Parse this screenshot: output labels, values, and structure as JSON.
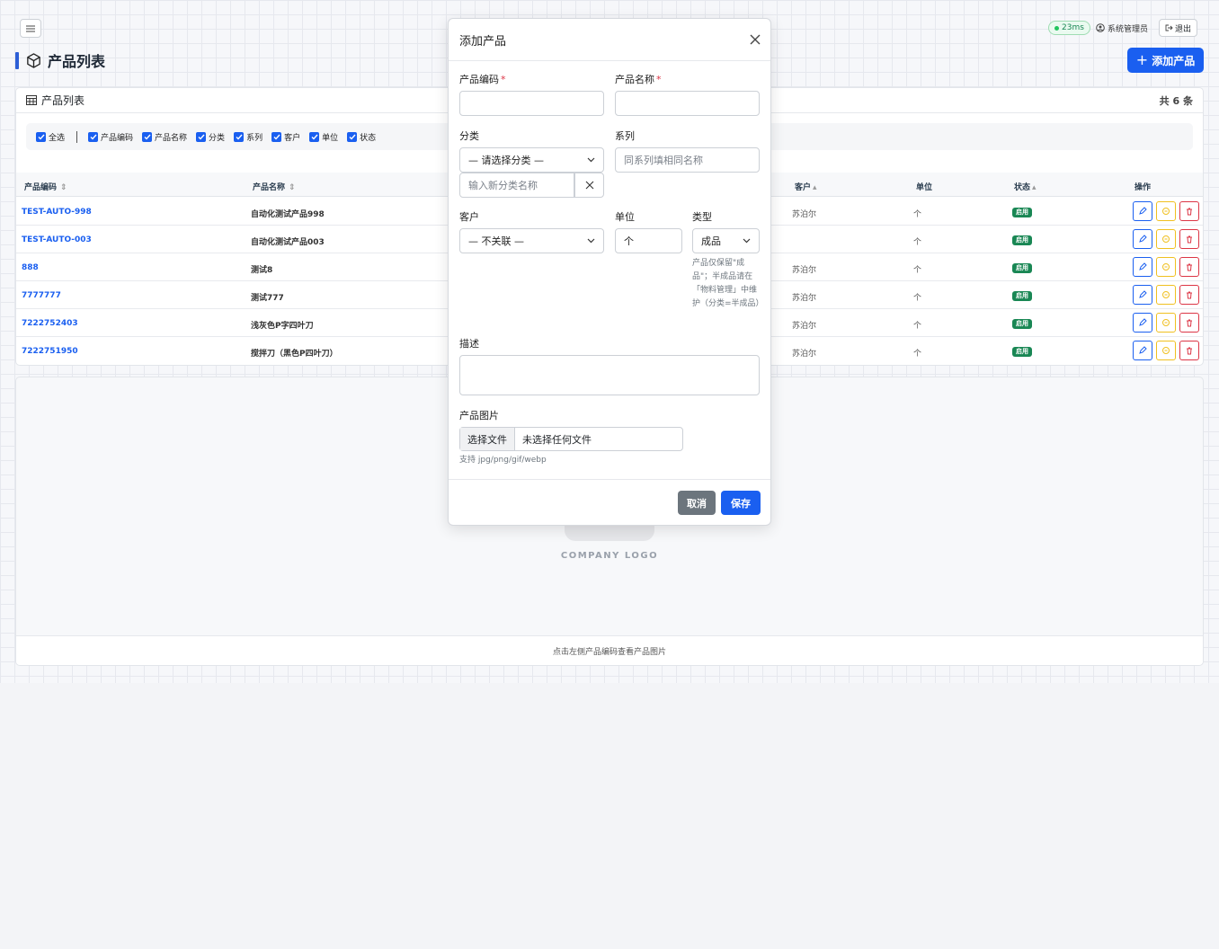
{
  "header": {
    "latency": "23ms",
    "user": "系统管理员",
    "logout": "退出"
  },
  "page": {
    "title": "产品列表",
    "add_button": "添加产品"
  },
  "list": {
    "title": "产品列表",
    "count": "共 6 条",
    "filters": [
      "全选",
      "产品编码",
      "产品名称",
      "分类",
      "系列",
      "客户",
      "单位",
      "状态"
    ],
    "columns": {
      "code": "产品编码",
      "name": "产品名称",
      "customer": "客户",
      "unit": "单位",
      "status": "状态",
      "actions": "操作"
    },
    "rows": [
      {
        "code": "TEST-AUTO-998",
        "name": "自动化测试产品998",
        "customer": "苏泊尔",
        "unit": "个",
        "status": "启用"
      },
      {
        "code": "TEST-AUTO-003",
        "name": "自动化测试产品003",
        "customer": "",
        "unit": "个",
        "status": "启用"
      },
      {
        "code": "888",
        "name": "测试8",
        "customer": "苏泊尔",
        "unit": "个",
        "status": "启用"
      },
      {
        "code": "7777777",
        "name": "测试777",
        "customer": "苏泊尔",
        "unit": "个",
        "status": "启用"
      },
      {
        "code": "7222752403",
        "name": "浅灰色P字四叶刀",
        "customer": "苏泊尔",
        "unit": "个",
        "status": "启用"
      },
      {
        "code": "7222751950",
        "name": "搅拌刀（黑色P四叶刀）",
        "customer": "苏泊尔",
        "unit": "个",
        "status": "启用"
      }
    ]
  },
  "preview": {
    "logo_text": "COMPANY LOGO",
    "footer_hint": "点击左侧产品编码查看产品图片"
  },
  "modal": {
    "title": "添加产品",
    "code_label": "产品编码",
    "name_label": "产品名称",
    "category_label": "分类",
    "category_value": "— 请选择分类 —",
    "new_category_placeholder": "输入新分类名称",
    "series_label": "系列",
    "series_placeholder": "同系列填相同名称",
    "customer_label": "客户",
    "customer_value": "— 不关联 —",
    "unit_label": "单位",
    "unit_value": "个",
    "type_label": "类型",
    "type_value": "成品",
    "type_hint": "产品仅保留\"成品\"；半成品请在「物料管理」中维护（分类=半成品）",
    "description_label": "描述",
    "image_label": "产品图片",
    "file_button": "选择文件",
    "file_status": "未选择任何文件",
    "file_hint": "支持 jpg/png/gif/webp",
    "cancel": "取消",
    "save": "保存"
  },
  "colors": {
    "primary": "#1a5ff0",
    "success": "#198754",
    "danger": "#dc3545",
    "warning": "#f0c020",
    "secondary": "#6c757d"
  }
}
